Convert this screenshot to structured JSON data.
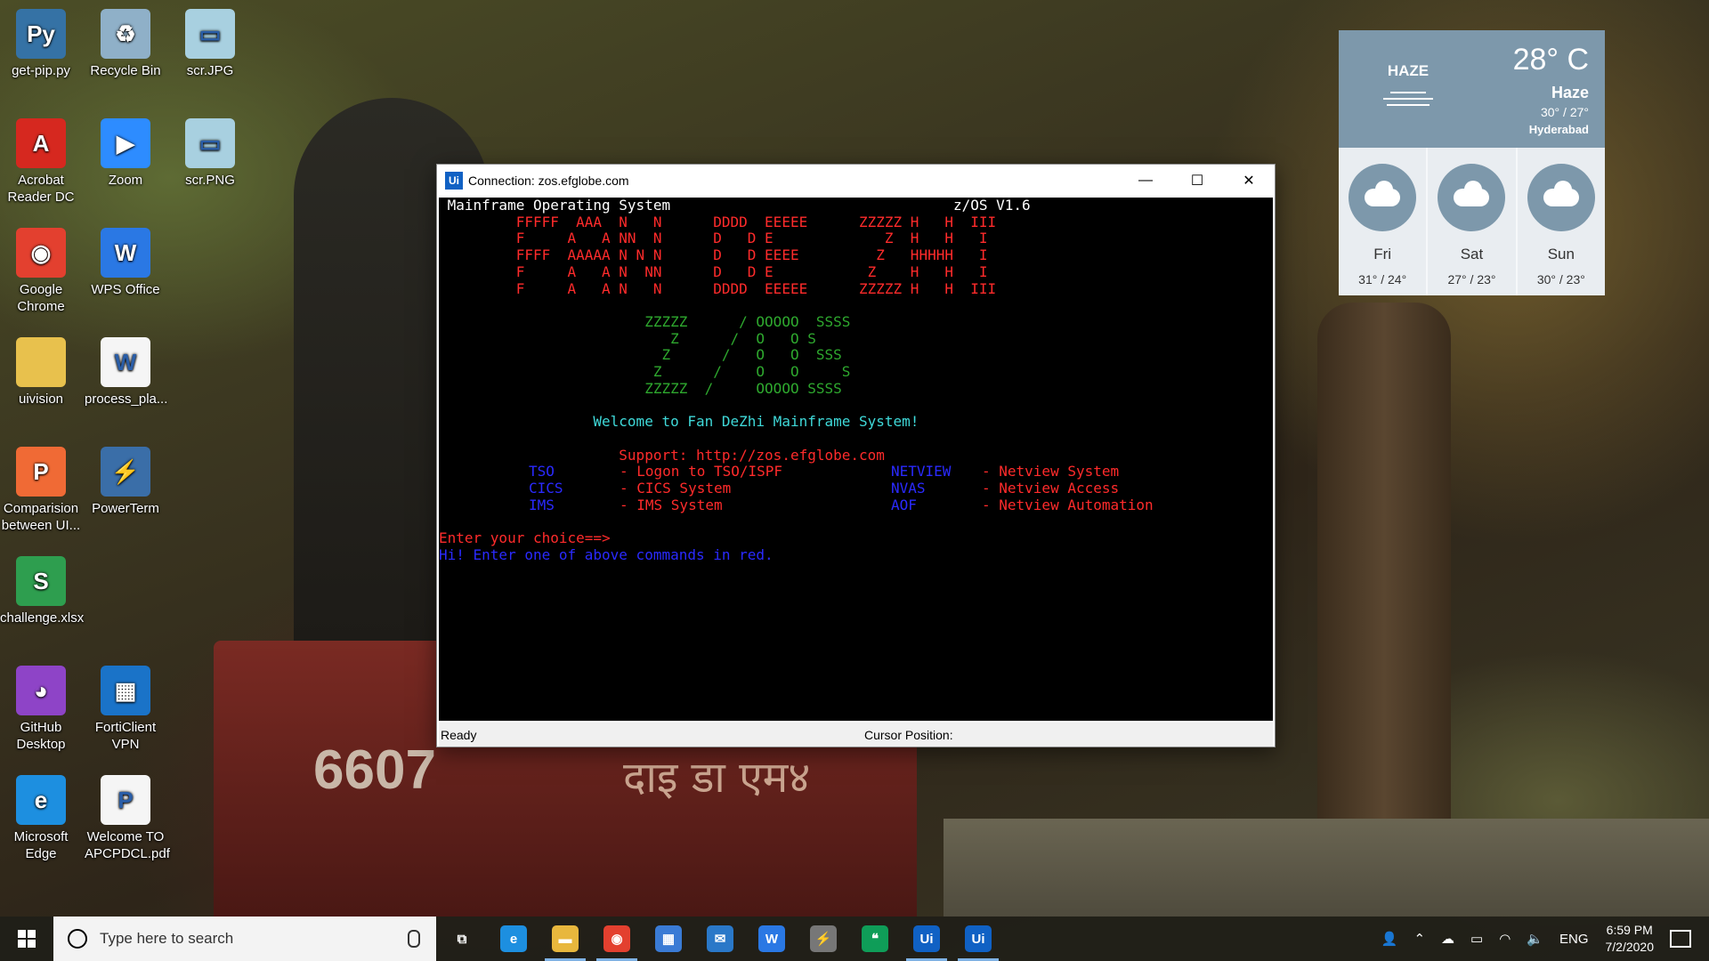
{
  "desktop_icons": [
    {
      "label": "get-pip.py",
      "icon": "python-file-icon",
      "color": "#3572a5",
      "glyph": "Py"
    },
    {
      "label": "Recycle Bin",
      "icon": "recycle-bin-icon",
      "color": "#8fb0c8",
      "glyph": "♻"
    },
    {
      "label": "scr.JPG",
      "icon": "image-file-icon",
      "color": "#a8d0e0",
      "glyph": "▭"
    },
    {
      "label": "Acrobat Reader DC",
      "icon": "acrobat-icon",
      "color": "#d6281f",
      "glyph": "A"
    },
    {
      "label": "Zoom",
      "icon": "zoom-icon",
      "color": "#2d8cff",
      "glyph": "▶"
    },
    {
      "label": "scr.PNG",
      "icon": "image-file-icon",
      "color": "#a8d0e0",
      "glyph": "▭"
    },
    {
      "label": "Google Chrome",
      "icon": "chrome-icon",
      "color": "#e3402f",
      "glyph": "◉"
    },
    {
      "label": "WPS Office",
      "icon": "wps-office-icon",
      "color": "#2a78e4",
      "glyph": "W"
    },
    {
      "label": "uivision",
      "icon": "folder-icon",
      "color": "#e8c14d",
      "glyph": ""
    },
    {
      "label": "process_pla...",
      "icon": "word-document-icon",
      "color": "#f5f5f5",
      "glyph": "W"
    },
    {
      "label": "Comparision between UI...",
      "icon": "presentation-file-icon",
      "color": "#f06a35",
      "glyph": "P"
    },
    {
      "label": "PowerTerm",
      "icon": "powerterm-icon",
      "color": "#3a6ea8",
      "glyph": "⚡"
    },
    {
      "label": "challenge.xlsx",
      "icon": "spreadsheet-file-icon",
      "color": "#2e9e4f",
      "glyph": "S"
    },
    {
      "label": "GitHub Desktop",
      "icon": "github-desktop-icon",
      "color": "#8e44c7",
      "glyph": "◕"
    },
    {
      "label": "FortiClient VPN",
      "icon": "forticlient-icon",
      "color": "#1a73c8",
      "glyph": "▦"
    },
    {
      "label": "Microsoft Edge",
      "icon": "edge-icon",
      "color": "#1d8fe0",
      "glyph": "e"
    },
    {
      "label": "Welcome TO APCPDCL.pdf",
      "icon": "pdf-file-icon",
      "color": "#f5f5f5",
      "glyph": "P"
    }
  ],
  "weather": {
    "condition_label": "HAZE",
    "temperature": "28° C",
    "condition": "Haze",
    "range": "30° / 27°",
    "city": "Hyderabad",
    "forecast": [
      {
        "day": "Fri",
        "range": "31° / 24°"
      },
      {
        "day": "Sat",
        "range": "27° / 23°"
      },
      {
        "day": "Sun",
        "range": "30° / 23°"
      }
    ]
  },
  "window": {
    "badge": "Ui",
    "title": "Connection: zos.efglobe.com",
    "minimize": "—",
    "maximize": "☐",
    "close": "✕",
    "status_left": "Ready",
    "status_cursor": "Cursor Position:"
  },
  "terminal": {
    "lines": [
      {
        "text": " Mainframe Operating System                                 z/OS V1.6",
        "color": "white"
      },
      {
        "text": "         FFFFF  AAA  N   N      DDDD  EEEEE      ZZZZZ H   H  III",
        "color": "red"
      },
      {
        "text": "         F     A   A NN  N      D   D E             Z  H   H   I",
        "color": "red"
      },
      {
        "text": "         FFFF  AAAAA N N N      D   D EEEE         Z   HHHHH   I",
        "color": "red"
      },
      {
        "text": "         F     A   A N  NN      D   D E           Z    H   H   I",
        "color": "red"
      },
      {
        "text": "         F     A   A N   N      DDDD  EEEEE      ZZZZZ H   H  III",
        "color": "red"
      },
      {
        "text": "",
        "color": "red"
      },
      {
        "text": "                        ZZZZZ      / OOOOO  SSSS",
        "color": "green"
      },
      {
        "text": "                           Z      /  O   O S",
        "color": "green"
      },
      {
        "text": "                          Z      /   O   O  SSS",
        "color": "green"
      },
      {
        "text": "                         Z      /    O   O     S",
        "color": "green"
      },
      {
        "text": "                        ZZZZZ  /     OOOOO SSSS",
        "color": "green"
      },
      {
        "text": "",
        "color": "green"
      },
      {
        "text": "                  Welcome to Fan DeZhi Mainframe System!",
        "color": "cyan"
      },
      {
        "text": "",
        "color": "cyan"
      },
      {
        "text": "                     Support: http://zos.efglobe.com",
        "color": "red"
      },
      {
        "text": "",
        "color": "red"
      },
      {
        "text": "",
        "color": "red"
      },
      {
        "text": "",
        "color": "red"
      },
      {
        "text": "",
        "color": "red"
      },
      {
        "text": "Enter your choice==>",
        "color": "red"
      },
      {
        "text": "Hi! Enter one of above commands in red.",
        "color": "blue"
      }
    ],
    "menu": [
      {
        "cmd": "TSO",
        "desc": "- Logon to TSO/ISPF",
        "cmd2": "NETVIEW",
        "desc2": "- Netview System"
      },
      {
        "cmd": "CICS",
        "desc": "- CICS System",
        "cmd2": "NVAS",
        "desc2": "- Netview Access"
      },
      {
        "cmd": "IMS",
        "desc": "- IMS System",
        "cmd2": "AOF",
        "desc2": "- Netview Automation"
      }
    ]
  },
  "taskbar": {
    "search_placeholder": "Type here to search",
    "apps": [
      {
        "name": "task-view",
        "glyph": "⧉",
        "color": "transparent"
      },
      {
        "name": "edge",
        "glyph": "e",
        "color": "#1d8fe0"
      },
      {
        "name": "file-explorer",
        "glyph": "▬",
        "color": "#e8b73d"
      },
      {
        "name": "chrome",
        "glyph": "◉",
        "color": "#e3402f"
      },
      {
        "name": "microsoft-store",
        "glyph": "▦",
        "color": "#3a7bd5"
      },
      {
        "name": "mail",
        "glyph": "✉",
        "color": "#2a78c8"
      },
      {
        "name": "wps-office",
        "glyph": "W",
        "color": "#2a78e4"
      },
      {
        "name": "powerterm",
        "glyph": "⚡",
        "color": "#777777"
      },
      {
        "name": "hangouts",
        "glyph": "❝",
        "color": "#0f9d58"
      },
      {
        "name": "uipath-1",
        "glyph": "Ui",
        "color": "#1061c4"
      },
      {
        "name": "uipath-2",
        "glyph": "Ui",
        "color": "#1061c4"
      }
    ],
    "tray": {
      "language": "ENG",
      "time": "6:59 PM",
      "date": "7/2/2020"
    }
  }
}
